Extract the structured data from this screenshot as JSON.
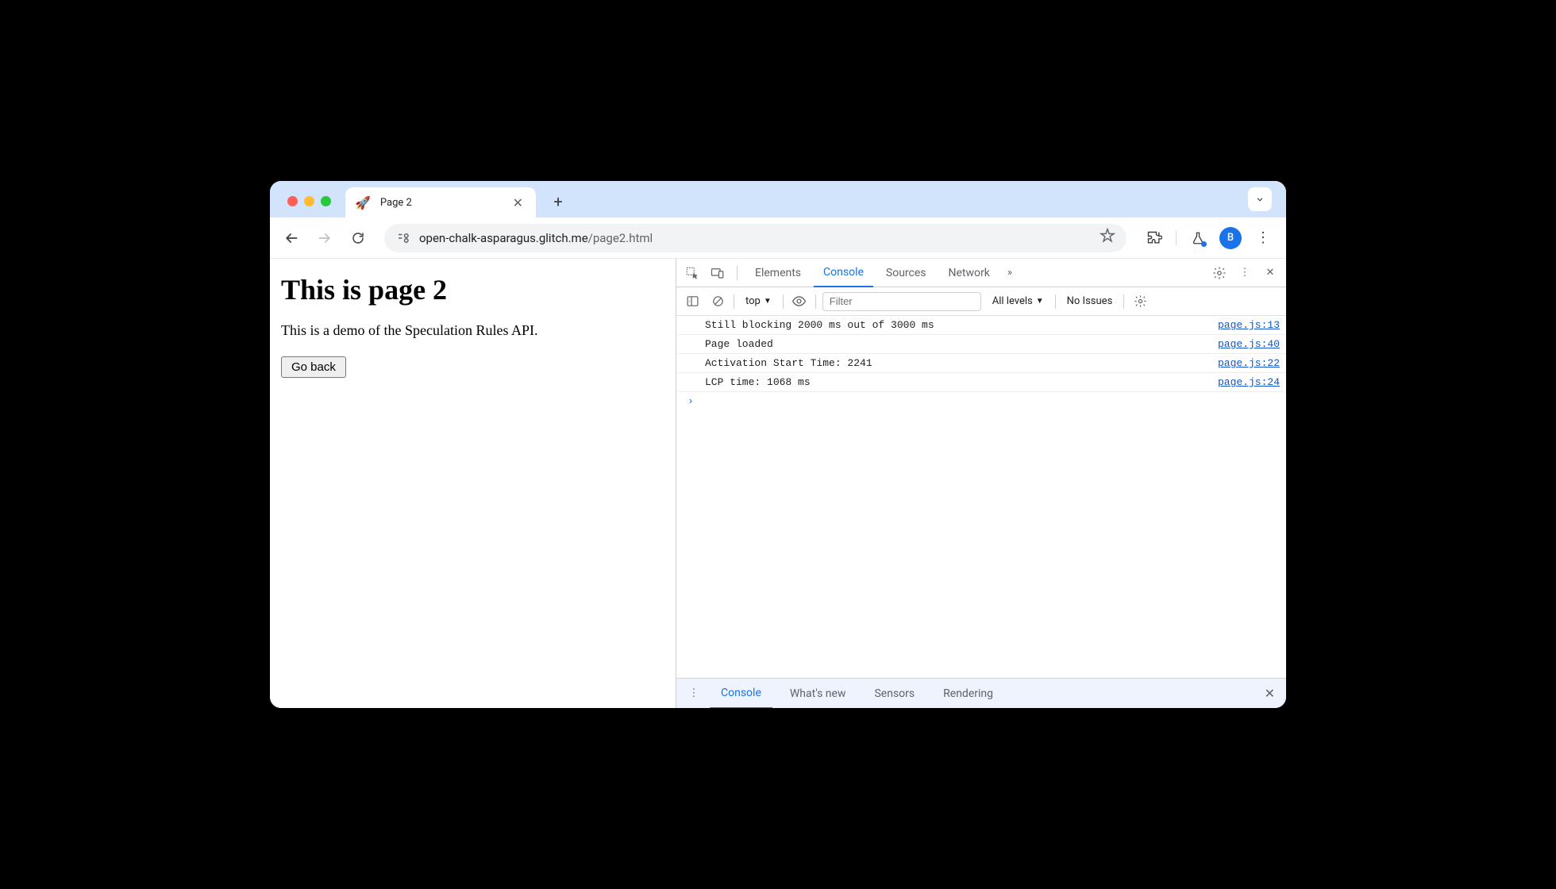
{
  "browser": {
    "tab": {
      "favicon": "🚀",
      "title": "Page 2"
    },
    "url": {
      "domain": "open-chalk-asparagus.glitch.me",
      "path": "/page2.html"
    },
    "avatar_letter": "B"
  },
  "page": {
    "heading": "This is page 2",
    "paragraph": "This is a demo of the Speculation Rules API.",
    "button_label": "Go back"
  },
  "devtools": {
    "main_tabs": {
      "elements": "Elements",
      "console": "Console",
      "sources": "Sources",
      "network": "Network",
      "more": "»"
    },
    "console_toolbar": {
      "context": "top",
      "filter_placeholder": "Filter",
      "levels": "All levels",
      "issues": "No Issues"
    },
    "console_rows": [
      {
        "msg": "Still blocking 2000 ms out of 3000 ms",
        "src": "page.js:13"
      },
      {
        "msg": "Page loaded",
        "src": "page.js:40"
      },
      {
        "msg": "Activation Start Time: 2241",
        "src": "page.js:22"
      },
      {
        "msg": "LCP time: 1068 ms",
        "src": "page.js:24"
      }
    ],
    "prompt_char": "›",
    "drawer_tabs": {
      "console": "Console",
      "whatsnew": "What's new",
      "sensors": "Sensors",
      "rendering": "Rendering"
    }
  }
}
